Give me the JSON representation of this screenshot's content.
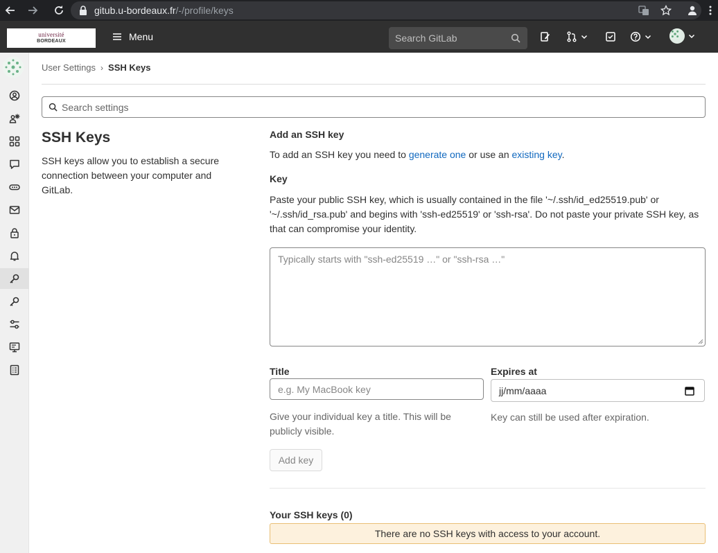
{
  "browser": {
    "url_host": "gitub.u-bordeaux.fr",
    "url_path": "/-/profile/keys"
  },
  "topnav": {
    "logo_line1": "université",
    "logo_line2": "BORDEAUX",
    "menu_label": "Menu",
    "search_placeholder": "Search GitLab"
  },
  "breadcrumb": {
    "parent": "User Settings",
    "separator": "›",
    "current": "SSH Keys"
  },
  "settings_search": {
    "placeholder": "Search settings"
  },
  "section": {
    "title": "SSH Keys",
    "description": "SSH keys allow you to establish a secure connection between your computer and GitLab."
  },
  "form": {
    "heading": "Add an SSH key",
    "intro_prefix": "To add an SSH key you need to ",
    "intro_link1": "generate one",
    "intro_middle": " or use an ",
    "intro_link2": "existing key",
    "intro_suffix": ".",
    "key_label": "Key",
    "key_help": "Paste your public SSH key, which is usually contained in the file '~/.ssh/id_ed25519.pub' or '~/.ssh/id_rsa.pub' and begins with 'ssh-ed25519' or 'ssh-rsa'. Do not paste your private SSH key, as that can compromise your identity.",
    "key_placeholder": "Typically starts with \"ssh-ed25519 …\" or \"ssh-rsa …\"",
    "title_label": "Title",
    "title_placeholder": "e.g. My MacBook key",
    "title_help": "Give your individual key a title. This will be publicly visible.",
    "expires_label": "Expires at",
    "expires_value": "jj/mm/aaaa",
    "expires_help": "Key can still be used after expiration.",
    "add_button": "Add key"
  },
  "keys_list": {
    "heading": "Your SSH keys (0)",
    "empty_message": "There are no SSH keys with access to your account."
  },
  "colors": {
    "navbar": "#303030",
    "link": "#1068bf",
    "alert_bg": "#fdf1dd"
  }
}
